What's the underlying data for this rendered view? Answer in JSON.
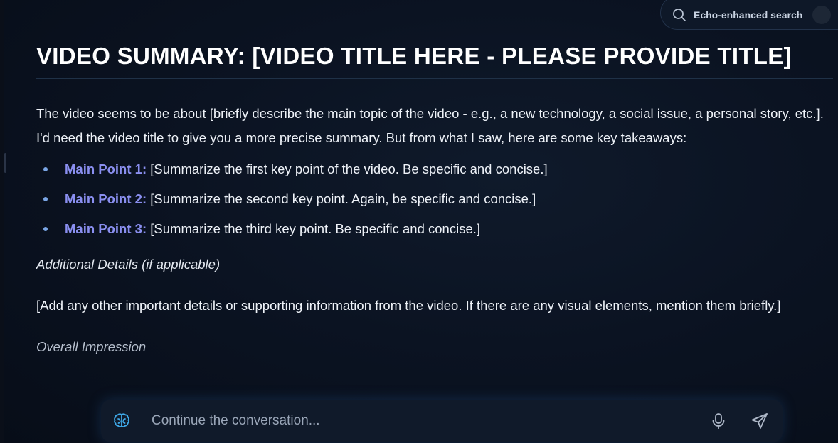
{
  "search": {
    "label": "Echo-enhanced search",
    "icon": "search-icon"
  },
  "summary": {
    "title": "VIDEO SUMMARY: [VIDEO TITLE HERE - PLEASE PROVIDE TITLE]",
    "intro": "The video seems to be about [briefly describe the main topic of the video - e.g., a new technology, a social issue, a personal story, etc.]. I'd need the video title to give you a more precise summary. But from what I saw, here are some key takeaways:",
    "points": [
      {
        "label": "Main Point 1:",
        "text": " [Summarize the first key point of the video. Be specific and concise.]"
      },
      {
        "label": "Main Point 2:",
        "text": " [Summarize the second key point. Again, be specific and concise.]"
      },
      {
        "label": "Main Point 3:",
        "text": " [Summarize the third key point. Be specific and concise.]"
      }
    ],
    "additional_heading": "Additional Details (if applicable)",
    "additional_text": "[Add any other important details or supporting information from the video. If there are any visual elements, mention them briefly.]",
    "overall_heading": "Overall Impression"
  },
  "chat": {
    "placeholder": "Continue the conversation...",
    "brain_icon": "brain-icon",
    "mic_icon": "microphone-icon",
    "send_icon": "send-icon"
  },
  "colors": {
    "background": "#0b1322",
    "accent_point_label": "#8a8ff0",
    "bullet": "#7aa6e6",
    "brain_icon": "#3fa9e8"
  }
}
